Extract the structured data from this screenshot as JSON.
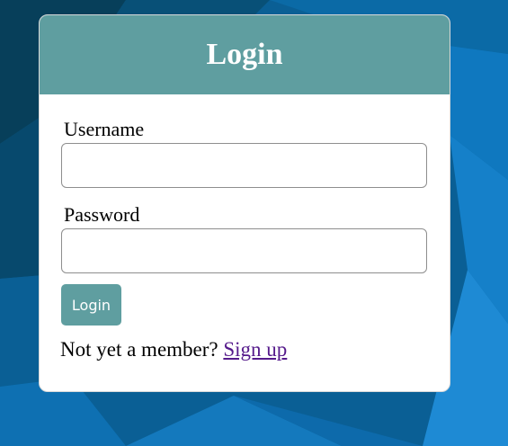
{
  "colors": {
    "accent": "#5f9ea0",
    "card_background": "#ffffff",
    "link": "#551a8b"
  },
  "login_card": {
    "title": "Login",
    "username": {
      "label": "Username",
      "value": "",
      "placeholder": ""
    },
    "password": {
      "label": "Password",
      "value": "",
      "placeholder": ""
    },
    "submit_label": "Login",
    "signup_prompt": "Not yet a member?",
    "signup_link": "Sign up"
  }
}
